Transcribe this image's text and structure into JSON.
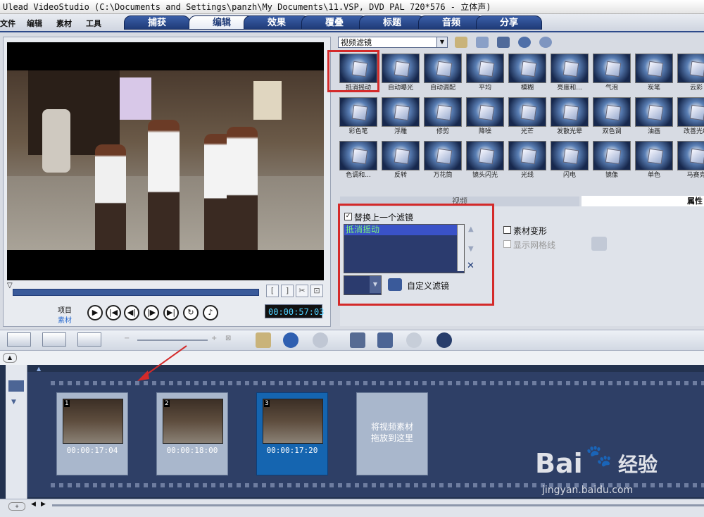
{
  "window": {
    "title": "Ulead VideoStudio (C:\\Documents and Settings\\panzh\\My Documents\\11.VSP, DVD PAL 720*576 - 立体声)"
  },
  "menu": [
    "文件",
    "编辑",
    "素材",
    "工具"
  ],
  "tabs": [
    {
      "label": "捕获",
      "active": false
    },
    {
      "label": "编辑",
      "active": true
    },
    {
      "label": "效果",
      "active": false
    },
    {
      "label": "覆叠",
      "active": false
    },
    {
      "label": "标题",
      "active": false
    },
    {
      "label": "音频",
      "active": false
    },
    {
      "label": "分享",
      "active": false
    }
  ],
  "preview": {
    "mode_project": "项目",
    "mode_clip": "素材",
    "timecode": "00:00:57:03"
  },
  "library": {
    "dropdown": "视频滤镜",
    "filters": [
      "抵消摇动",
      "自动曝光",
      "自动调配",
      "平均",
      "模糊",
      "亮度和...",
      "气泡",
      "炭笔",
      "云彩",
      "彩色笔",
      "浮雕",
      "修剪",
      "降噪",
      "光芒",
      "发散光晕",
      "双色调",
      "油画",
      "改善光线",
      "色调和...",
      "反转",
      "万花筒",
      "镜头闪光",
      "光线",
      "闪电",
      "镜像",
      "单色",
      "马赛克"
    ]
  },
  "properties": {
    "tab_video": "视频",
    "tab_attr": "属性",
    "replace_last_filter_label": "替换上一个滤镜",
    "replace_last_filter_checked": true,
    "applied_filters": [
      "抵消摇动"
    ],
    "custom_filter_label": "自定义滤镜",
    "clip_transform_label": "素材变形",
    "show_grid_label": "显示网格线"
  },
  "storyboard": {
    "clips": [
      {
        "index": "1",
        "time": "00:00:17:04",
        "selected": false
      },
      {
        "index": "2",
        "time": "00:00:18:00",
        "selected": false
      },
      {
        "index": "3",
        "time": "00:00:17:20",
        "selected": true
      }
    ],
    "drop_hint_line1": "将视频素材",
    "drop_hint_line2": "拖放到这里"
  },
  "watermark": {
    "brand": "Bai",
    "brand_cn": "经验",
    "url": "jingyan.baidu.com"
  },
  "colors": {
    "tab_blue": "#1f3b78",
    "highlight_red": "#d42a2a",
    "selected_clip": "#1565b0",
    "list_green": "#7cf27a"
  }
}
